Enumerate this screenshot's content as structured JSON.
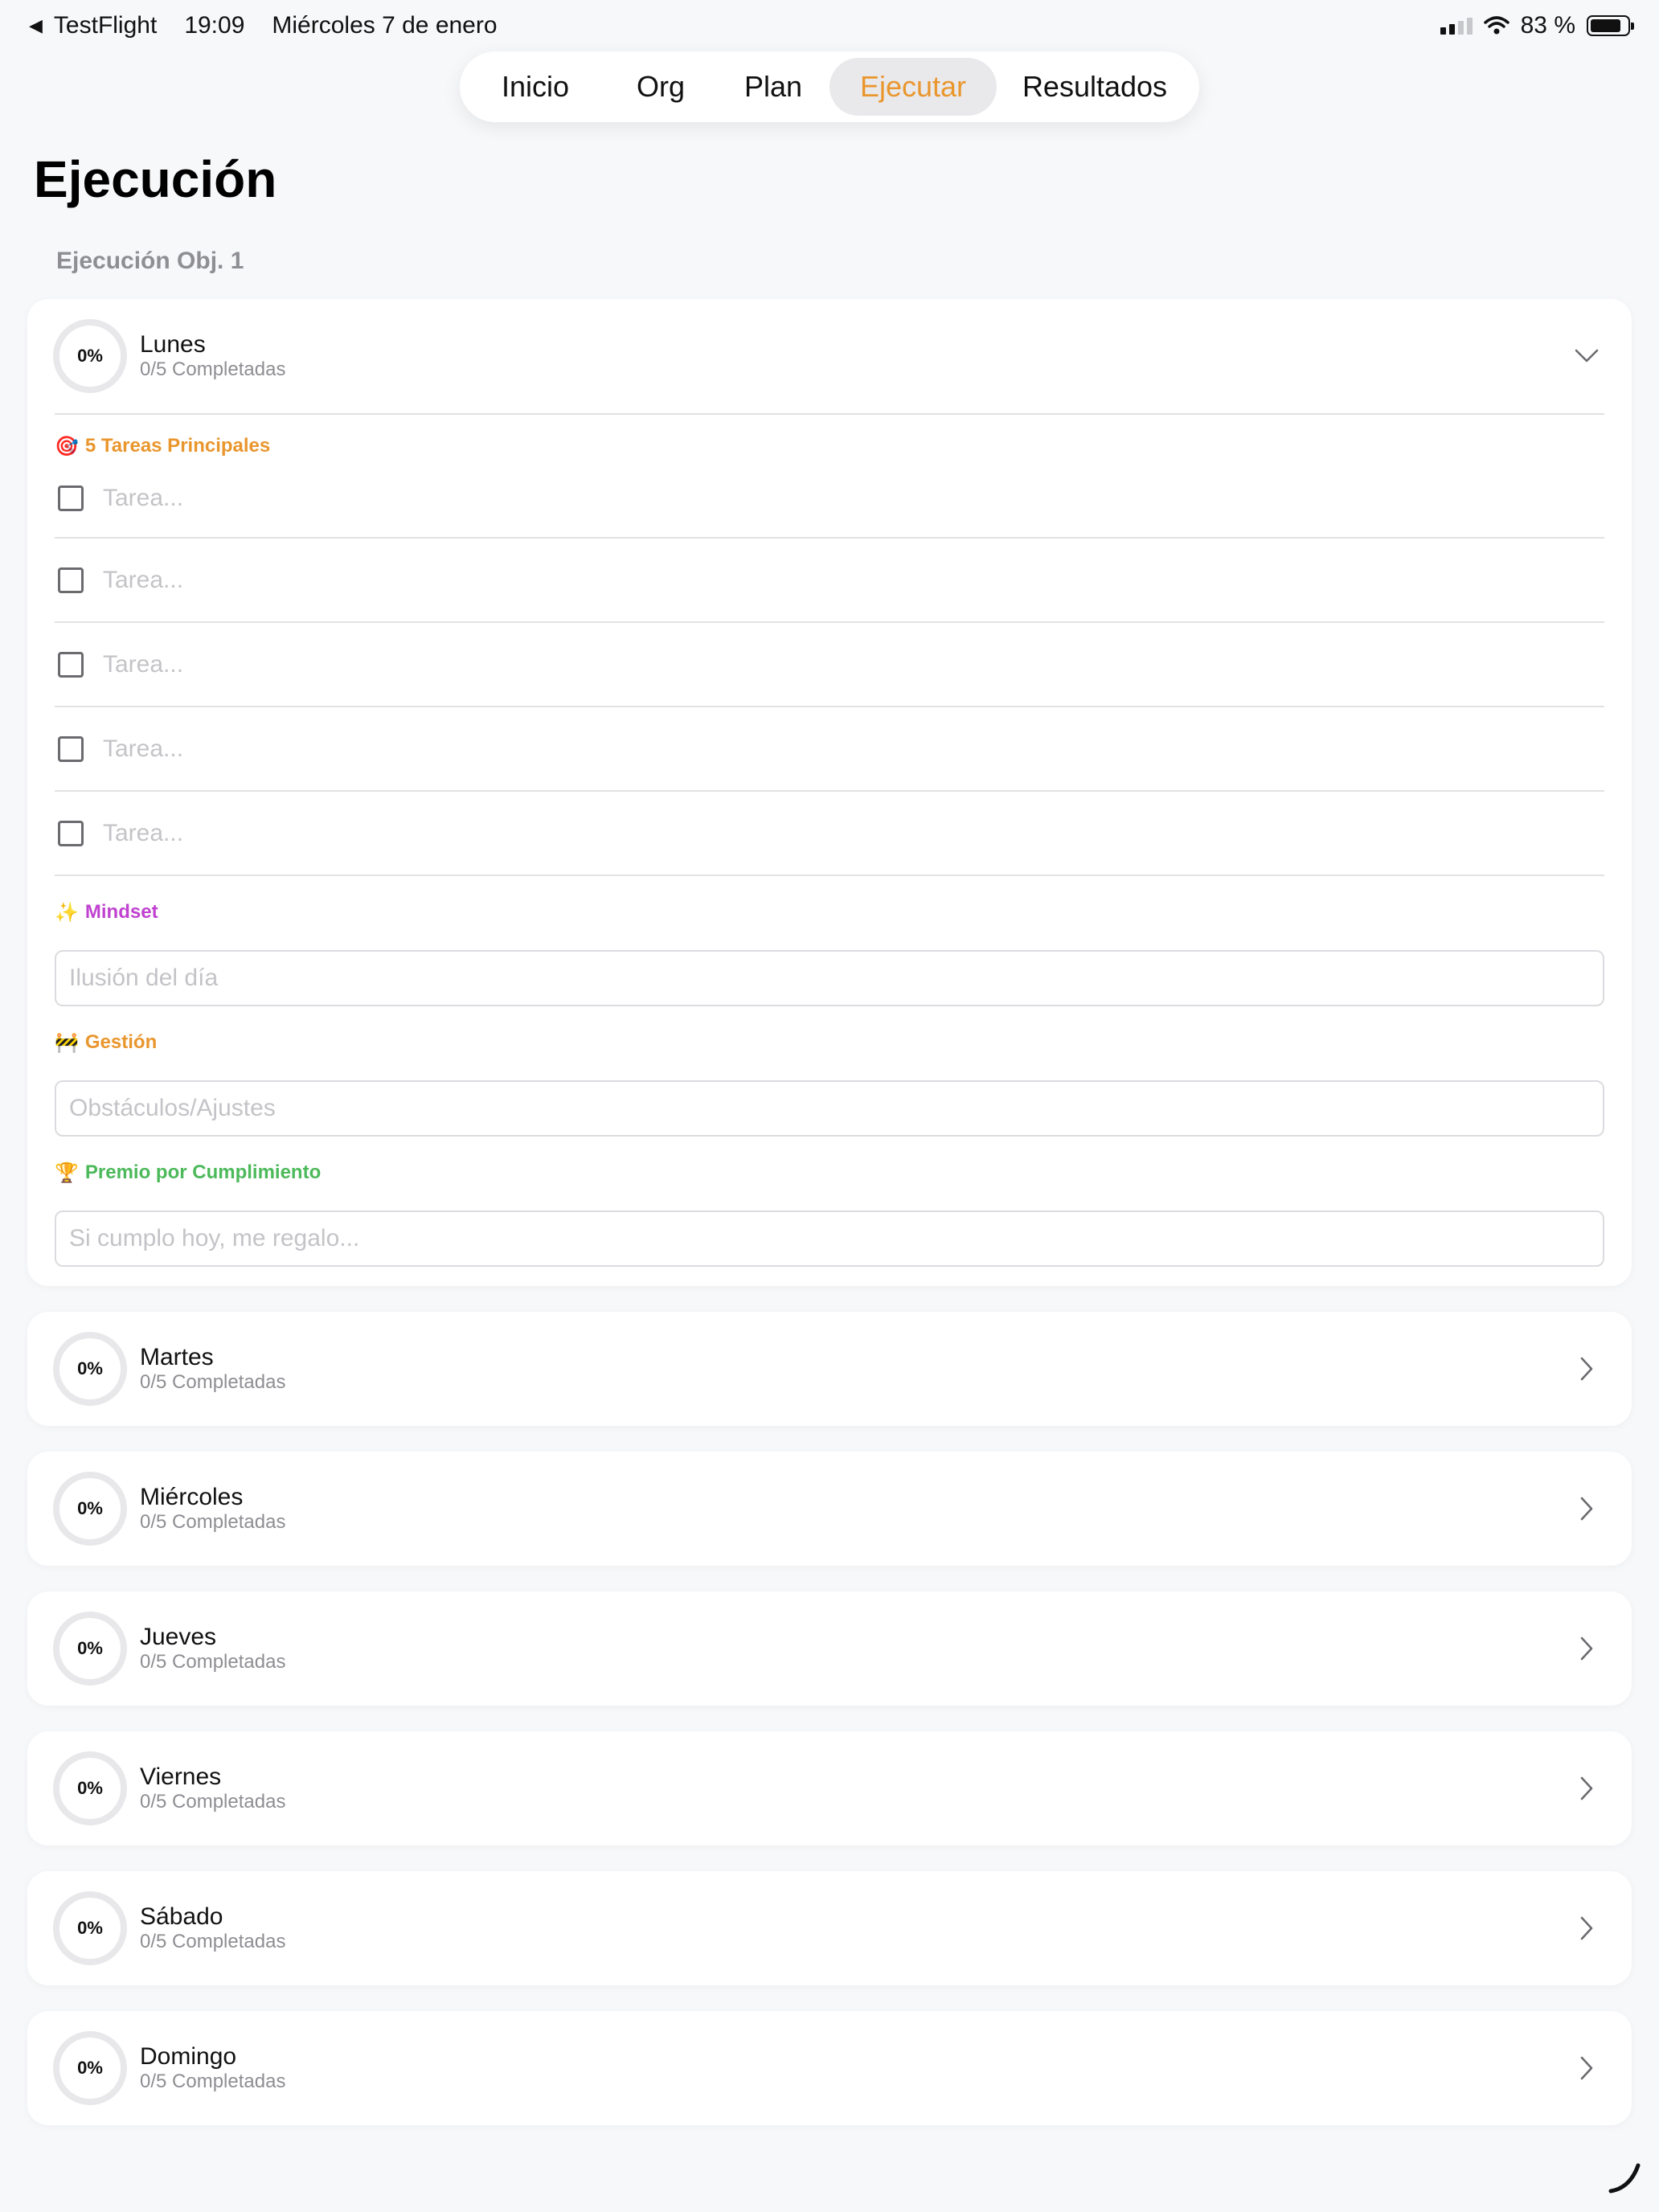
{
  "status_bar": {
    "back_app": "TestFlight",
    "time": "19:09",
    "date": "Miércoles 7 de enero",
    "battery": "83 %",
    "battery_level": 0.83
  },
  "nav": {
    "tabs": [
      {
        "label": "Inicio",
        "active": false
      },
      {
        "label": "Org",
        "active": false
      },
      {
        "label": "Plan",
        "active": false
      },
      {
        "label": "Ejecutar",
        "active": true
      },
      {
        "label": "Resultados",
        "active": false
      }
    ]
  },
  "page": {
    "title": "Ejecución",
    "section": "Ejecución Obj. 1"
  },
  "expanded_day": {
    "name": "Lunes",
    "progress": "0%",
    "completed": "0/5 Completadas",
    "tasks_label": "5 Tareas Principales",
    "tasks_icon": "🎯",
    "task_placeholder": "Tarea...",
    "tasks": [
      "",
      "",
      "",
      "",
      ""
    ],
    "mindset_label": "Mindset",
    "mindset_icon": "✨",
    "mindset_placeholder": "Ilusión del día",
    "gestion_label": "Gestión",
    "gestion_icon": "🚧",
    "gestion_placeholder": "Obstáculos/Ajustes",
    "premio_label": "Premio por Cumplimiento",
    "premio_icon": "🏆",
    "premio_placeholder": "Si cumplo hoy, me regalo..."
  },
  "days": [
    {
      "name": "Martes",
      "progress": "0%",
      "completed": "0/5 Completadas"
    },
    {
      "name": "Miércoles",
      "progress": "0%",
      "completed": "0/5 Completadas"
    },
    {
      "name": "Jueves",
      "progress": "0%",
      "completed": "0/5 Completadas"
    },
    {
      "name": "Viernes",
      "progress": "0%",
      "completed": "0/5 Completadas"
    },
    {
      "name": "Sábado",
      "progress": "0%",
      "completed": "0/5 Completadas"
    },
    {
      "name": "Domingo",
      "progress": "0%",
      "completed": "0/5 Completadas"
    }
  ],
  "colors": {
    "accent": "#e9962d",
    "tasks": "#e9962d",
    "mindset": "#c042d0",
    "gestion": "#e9962d",
    "premio": "#4cb95a"
  }
}
